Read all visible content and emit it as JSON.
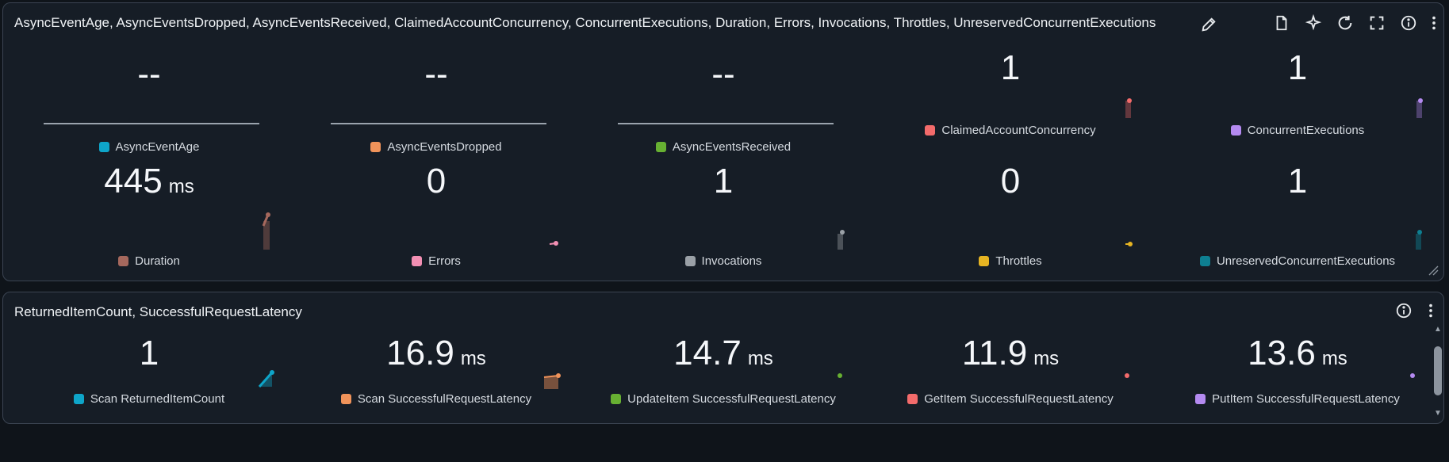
{
  "panel1": {
    "title": "AsyncEventAge, AsyncEventsDropped, AsyncEventsReceived, ClaimedAccountConcurrency, ConcurrentExecutions, Duration, Errors, Invocations, Throttles, UnreservedConcurrentExecutions",
    "row1": [
      {
        "value": "--",
        "unit": "",
        "label": "AsyncEventAge",
        "color": "#0ea5c9"
      },
      {
        "value": "--",
        "unit": "",
        "label": "AsyncEventsDropped",
        "color": "#f0935a"
      },
      {
        "value": "--",
        "unit": "",
        "label": "AsyncEventsReceived",
        "color": "#67b032"
      },
      {
        "value": "1",
        "unit": "",
        "label": "ClaimedAccountConcurrency",
        "color": "#f36b6b"
      },
      {
        "value": "1",
        "unit": "",
        "label": "ConcurrentExecutions",
        "color": "#b48af0"
      }
    ],
    "row2": [
      {
        "value": "445",
        "unit": "ms",
        "label": "Duration",
        "color": "#a5685d"
      },
      {
        "value": "0",
        "unit": "",
        "label": "Errors",
        "color": "#f28fb3"
      },
      {
        "value": "1",
        "unit": "",
        "label": "Invocations",
        "color": "#9aa0a6"
      },
      {
        "value": "0",
        "unit": "",
        "label": "Throttles",
        "color": "#e6b422"
      },
      {
        "value": "1",
        "unit": "",
        "label": "UnreservedConcurrentExecutions",
        "color": "#0e7f91"
      }
    ]
  },
  "panel2": {
    "title": "ReturnedItemCount, SuccessfulRequestLatency",
    "row": [
      {
        "value": "1",
        "unit": "",
        "label": "Scan ReturnedItemCount",
        "color": "#0ea5c9"
      },
      {
        "value": "16.9",
        "unit": "ms",
        "label": "Scan SuccessfulRequestLatency",
        "color": "#f0935a"
      },
      {
        "value": "14.7",
        "unit": "ms",
        "label": "UpdateItem SuccessfulRequestLatency",
        "color": "#67b032"
      },
      {
        "value": "11.9",
        "unit": "ms",
        "label": "GetItem SuccessfulRequestLatency",
        "color": "#f36b6b"
      },
      {
        "value": "13.6",
        "unit": "ms",
        "label": "PutItem SuccessfulRequestLatency",
        "color": "#b48af0"
      }
    ]
  },
  "icons": {
    "edit": "pencil-icon",
    "doc": "document-icon",
    "ai": "sparkle-icon",
    "refresh": "refresh-icon",
    "fullscreen": "expand-icon",
    "info": "info-icon",
    "menu": "kebab-menu-icon"
  }
}
